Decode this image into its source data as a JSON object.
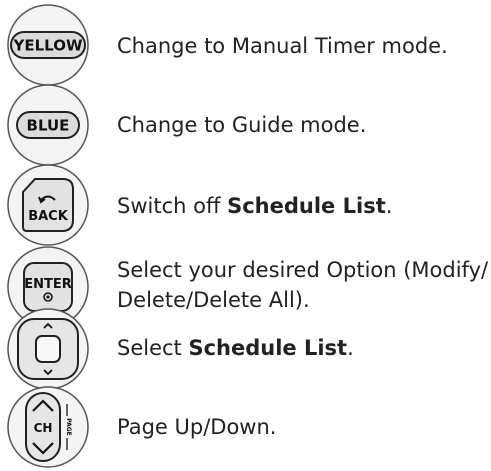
{
  "items": [
    {
      "icon": "yellow-button-icon",
      "key_label": "YELLOW",
      "text": "Change to Manual Timer mode."
    },
    {
      "icon": "blue-button-icon",
      "key_label": "BLUE",
      "text": "Change to Guide mode."
    },
    {
      "icon": "back-button-icon",
      "key_label": "BACK",
      "text_before": "Switch off ",
      "text_bold": "Schedule List",
      "text_after": "."
    },
    {
      "icon": "enter-button-icon",
      "key_label": "ENTER",
      "text_line1": "Select your desired Option (Modify/",
      "text_line2": "Delete/Delete All)."
    },
    {
      "icon": "navigation-pad-icon",
      "text_before": "Select ",
      "text_bold": "Schedule List",
      "text_after": "."
    },
    {
      "icon": "channel-page-rocker-icon",
      "key_label": "CH",
      "side_label": "PAGE",
      "text": "Page Up/Down."
    }
  ]
}
